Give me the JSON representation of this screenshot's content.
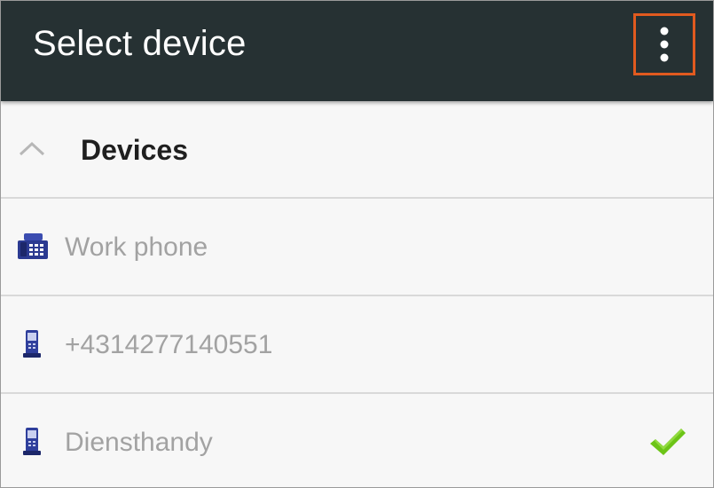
{
  "appbar": {
    "title": "Select device",
    "menu_icon": "more-vert-icon",
    "highlight_color": "#e15a1f",
    "background_color": "#263133"
  },
  "devices": {
    "header": "Devices",
    "collapse_icon": "chevron-up-icon",
    "items": [
      {
        "label": "Work phone",
        "icon": "desk-phone-icon",
        "selected": false
      },
      {
        "label": "+4314277140551",
        "icon": "mobile-phone-icon",
        "selected": false
      },
      {
        "label": "Diensthandy",
        "icon": "mobile-phone-icon",
        "selected": true
      }
    ],
    "selected_icon": "checkmark-icon",
    "selected_color": "#6cc417"
  }
}
